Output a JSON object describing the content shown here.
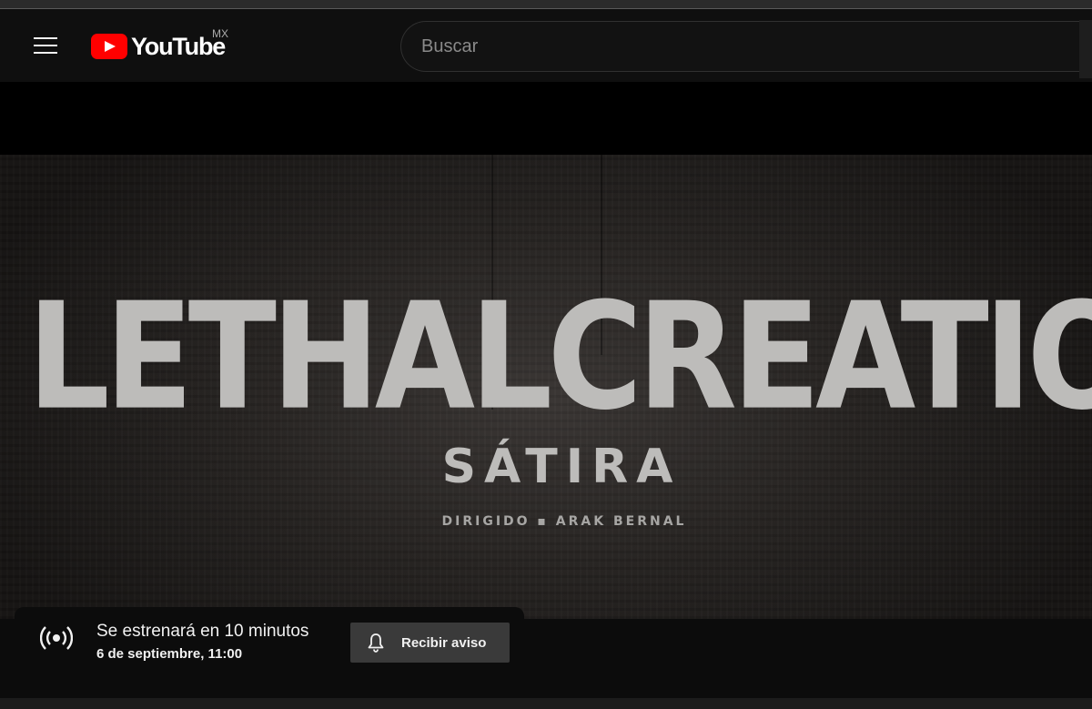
{
  "masthead": {
    "logo_text": "YouTube",
    "region": "MX",
    "search_placeholder": "Buscar"
  },
  "video": {
    "title_main": "LETHALCREATION",
    "title_sub": "SÁTIRA",
    "credit": "DIRIGIDO ▪ ARAK BERNAL"
  },
  "premiere": {
    "status": "Se estrenará en 10 minutos",
    "date": "6 de septiembre, 11:00",
    "notify_label": "Recibir aviso"
  },
  "icons": {
    "menu": "hamburger-menu-icon",
    "logo": "youtube-logo-icon",
    "live": "live-broadcast-icon",
    "bell": "bell-icon"
  },
  "colors": {
    "brand_red": "#ff0000",
    "background": "#0f0f0f",
    "button": "#3a3a3a"
  }
}
